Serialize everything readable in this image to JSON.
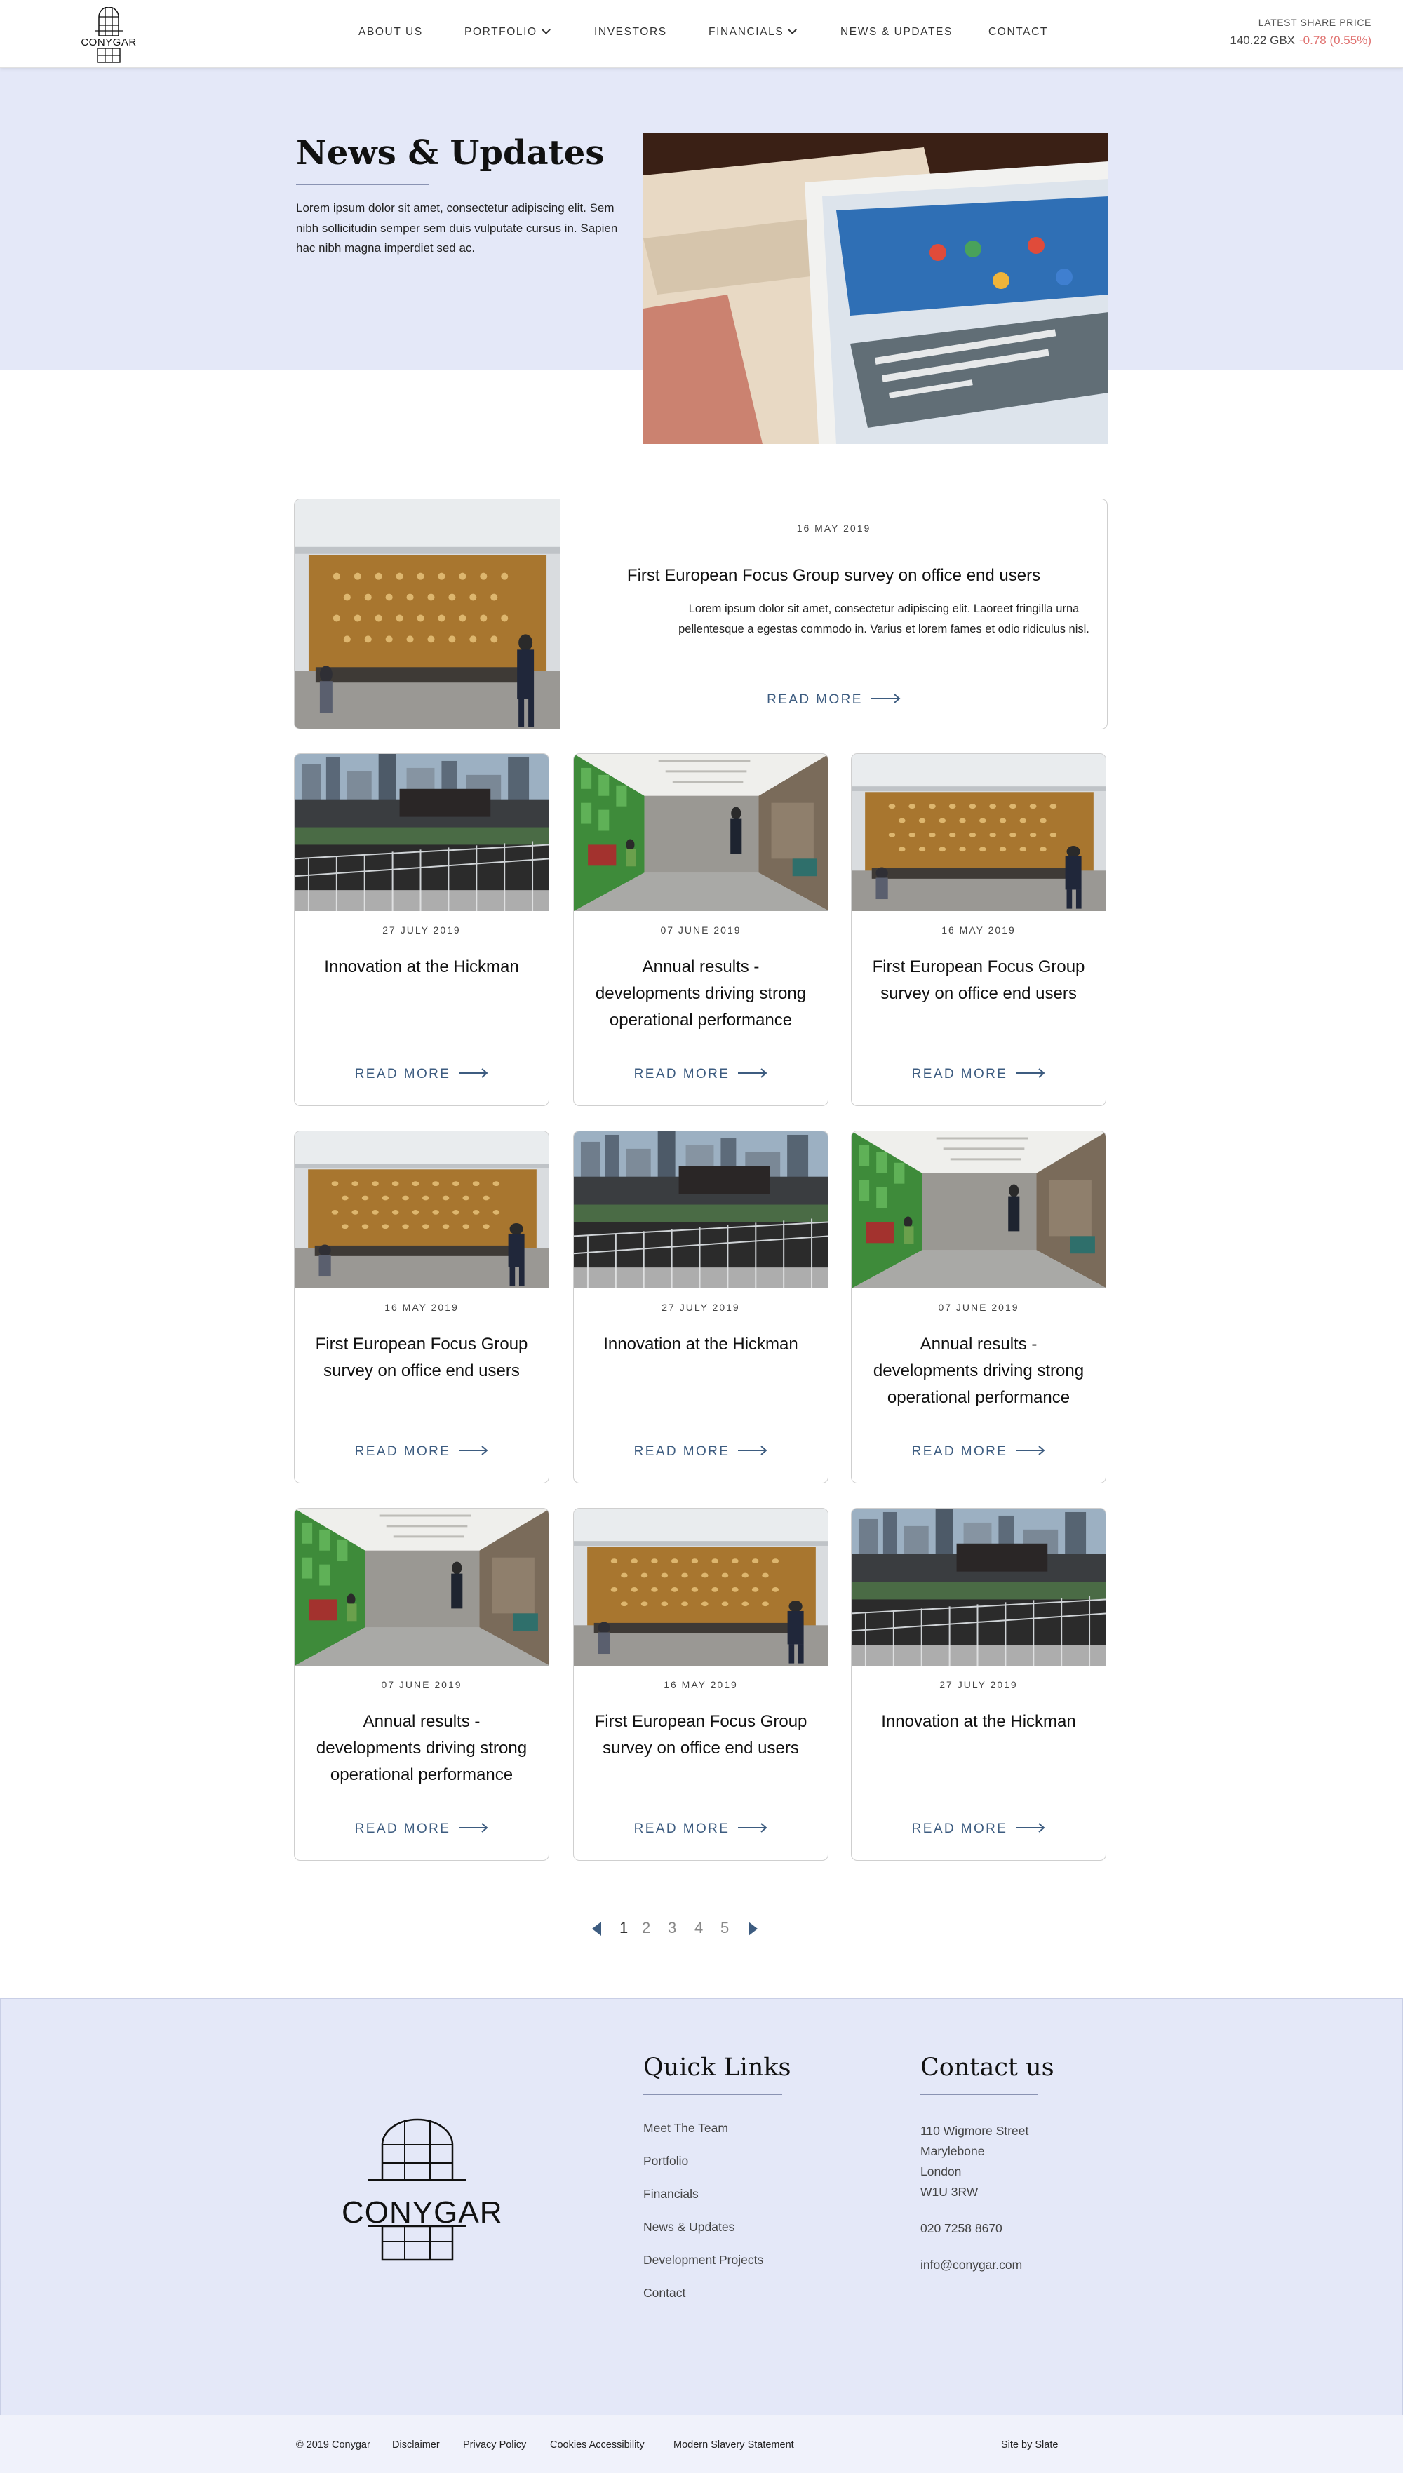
{
  "header": {
    "logo_text": "CONYGAR",
    "nav": [
      {
        "label": "ABOUT US",
        "has_dropdown": false
      },
      {
        "label": "PORTFOLIO",
        "has_dropdown": true
      },
      {
        "label": "INVESTORS",
        "has_dropdown": false
      },
      {
        "label": "FINANCIALS",
        "has_dropdown": true
      },
      {
        "label": "NEWS & UPDATES",
        "has_dropdown": false
      },
      {
        "label": "CONTACT",
        "has_dropdown": false
      }
    ],
    "share_price": {
      "label": "LATEST SHARE PRICE",
      "value": "140.22 GBX",
      "change": "-0.78 (0.55%)"
    }
  },
  "hero": {
    "title": "News & Updates",
    "intro": "Lorem ipsum dolor sit amet, consectetur adipiscing elit. Sem nibh sollicitudin semper sem duis vulputate cursus in. Sapien hac nibh magna imperdiet sed ac."
  },
  "featured": {
    "date": "16 MAY 2019",
    "title": "First European Focus Group survey on office end users",
    "excerpt": "Lorem ipsum dolor sit amet, consectetur adipiscing elit. Laoreet fringilla urna pellentesque a egestas commodo in. Varius et lorem fames et odio ridiculus nisl.",
    "read_more": "READ MORE"
  },
  "cards": [
    {
      "date": "27 JULY 2019",
      "title": "Innovation at the Hickman",
      "read_more": "READ MORE"
    },
    {
      "date": "07 JUNE 2019",
      "title": "Annual results - developments driving strong operational performance",
      "read_more": "READ MORE"
    },
    {
      "date": "16 MAY 2019",
      "title": "First European Focus Group survey on office end users",
      "read_more": "READ MORE"
    },
    {
      "date": "16 MAY 2019",
      "title": "First European Focus Group survey on office end users",
      "read_more": "READ MORE"
    },
    {
      "date": "27 JULY 2019",
      "title": "Innovation at the Hickman",
      "read_more": "READ MORE"
    },
    {
      "date": "07 JUNE 2019",
      "title": "Annual results - developments driving strong operational performance",
      "read_more": "READ MORE"
    },
    {
      "date": "07 JUNE 2019",
      "title": "Annual results - developments driving strong operational performance",
      "read_more": "READ MORE"
    },
    {
      "date": "16 MAY 2019",
      "title": "First European Focus Group survey on office end users",
      "read_more": "READ MORE"
    },
    {
      "date": "27 JULY 2019",
      "title": "Innovation at the Hickman",
      "read_more": "READ MORE"
    }
  ],
  "pagination": {
    "pages": [
      "1",
      "2",
      "3",
      "4",
      "5"
    ],
    "current": "1"
  },
  "footer": {
    "logo_text": "CONYGAR",
    "quick_links_title": "Quick Links",
    "quick_links": [
      "Meet The Team",
      "Portfolio",
      "Financials",
      "News & Updates",
      "Development Projects",
      "Contact"
    ],
    "contact_title": "Contact us",
    "address": [
      "110 Wigmore Street",
      "Marylebone",
      "London",
      "W1U 3RW"
    ],
    "phone": "020 7258 8670",
    "email": "info@conygar.com"
  },
  "subfooter": {
    "copyright": "© 2019 Conygar",
    "links": [
      "Disclaimer",
      "Privacy Policy",
      "Cookies Accessibility",
      "Modern Slavery Statement"
    ],
    "credit": "Site by Slate"
  },
  "colors": {
    "band": "#e4e8f8",
    "accent": "#3d5c80",
    "negative": "#e0716f"
  }
}
